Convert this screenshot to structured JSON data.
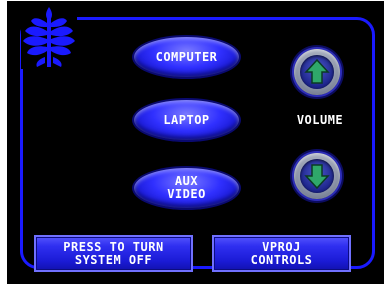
{
  "sources": {
    "computer_label": "COMPUTER",
    "laptop_label": "LAPTOP",
    "aux_video_label": "AUX\nVIDEO"
  },
  "volume": {
    "label": "VOLUME",
    "up_icon": "arrow-up-icon",
    "down_icon": "arrow-down-icon"
  },
  "bottom": {
    "system_off_label": "PRESS TO TURN\nSYSTEM OFF",
    "vproj_label": "VPROJ\nCONTROLS"
  },
  "logo": {
    "icon": "wheat-sheaf-logo"
  },
  "colors": {
    "background": "#000000",
    "accent": "#1a1aff",
    "button": "#2f2ff0",
    "volume_ring": "#8e96aa",
    "arrow": "#2fa86a",
    "text": "#ffffff"
  }
}
